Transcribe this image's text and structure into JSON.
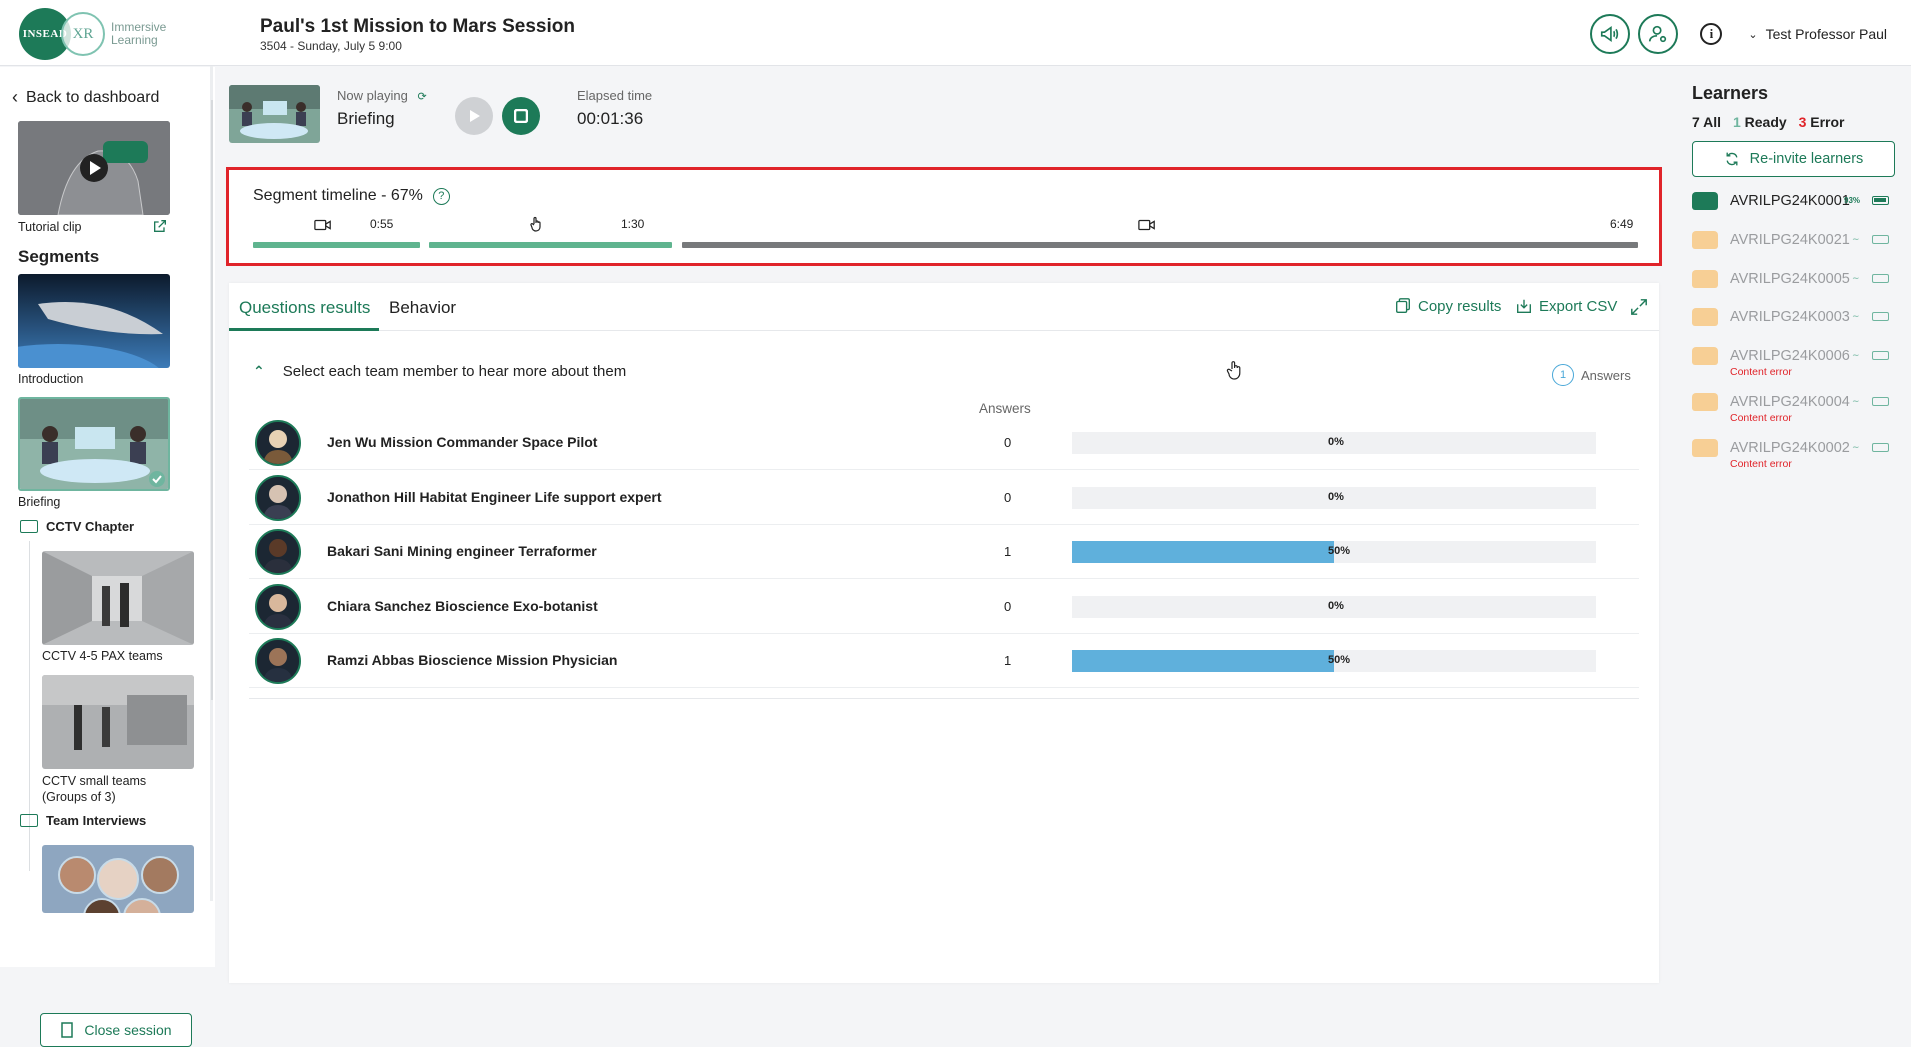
{
  "header": {
    "logo_text": "INSEAD",
    "logo_xr": "XR",
    "logo_line1": "Immersive",
    "logo_line2": "Learning",
    "session_title": "Paul's 1st Mission to Mars Session",
    "session_subtitle": "3504 - Sunday, July 5  9:00",
    "user_name": "Test Professor Paul"
  },
  "sidebar": {
    "back_label": "Back to dashboard",
    "tutorial_label": "Tutorial clip",
    "segments_title": "Segments",
    "segments": [
      {
        "label": "Introduction"
      },
      {
        "label": "Briefing"
      }
    ],
    "chapters": [
      {
        "label": "CCTV Chapter",
        "items": [
          "CCTV 4-5 PAX teams",
          "CCTV small teams",
          "(Groups of 3)"
        ]
      },
      {
        "label": "Team Interviews"
      }
    ],
    "close_label": "Close session"
  },
  "player": {
    "now_playing_label": "Now playing",
    "now_playing_value": "Briefing",
    "elapsed_label": "Elapsed time",
    "elapsed_value": "00:01:36"
  },
  "timeline": {
    "title": "Segment timeline - 67%",
    "markers": [
      "0:55",
      "1:30",
      "6:49"
    ],
    "progress_fraction": 0.67
  },
  "results": {
    "tabs": [
      "Questions results",
      "Behavior"
    ],
    "copy_label": "Copy results",
    "export_label": "Export CSV",
    "question": "Select each team member to hear more about them",
    "answers_count": "1",
    "answers_label": "Answers",
    "answers_col": "Answers",
    "rows": [
      {
        "name": "Jen Wu Mission Commander Space Pilot",
        "count": "0",
        "pct": "0%",
        "fraction": 0
      },
      {
        "name": "Jonathon Hill Habitat Engineer Life support expert",
        "count": "0",
        "pct": "0%",
        "fraction": 0
      },
      {
        "name": "Bakari Sani Mining engineer Terraformer",
        "count": "1",
        "pct": "50%",
        "fraction": 0.5
      },
      {
        "name": "Chiara Sanchez Bioscience Exo-botanist",
        "count": "0",
        "pct": "0%",
        "fraction": 0
      },
      {
        "name": "Ramzi Abbas Bioscience Mission Physician",
        "count": "1",
        "pct": "50%",
        "fraction": 0.5
      }
    ]
  },
  "learners": {
    "title": "Learners",
    "all_count": "7",
    "all_label": "All",
    "ready_count": "1",
    "ready_label": "Ready",
    "error_count": "3",
    "error_label": "Error",
    "reinvite_label": "Re-invite learners",
    "items": [
      {
        "name": "AVRILPG24K0001",
        "battery": "93%",
        "error": ""
      },
      {
        "name": "AVRILPG24K0021",
        "battery": "",
        "error": ""
      },
      {
        "name": "AVRILPG24K0005",
        "battery": "",
        "error": ""
      },
      {
        "name": "AVRILPG24K0003",
        "battery": "",
        "error": ""
      },
      {
        "name": "AVRILPG24K0006",
        "battery": "",
        "error": "Content error"
      },
      {
        "name": "AVRILPG24K0004",
        "battery": "",
        "error": "Content error"
      },
      {
        "name": "AVRILPG24K0002",
        "battery": "",
        "error": "Content error"
      }
    ]
  },
  "colors": {
    "brand_green": "#1d7a58",
    "highlight_red": "#e0242a",
    "bar_blue": "#5fb0dc",
    "offline_orange": "#f7cf95"
  }
}
